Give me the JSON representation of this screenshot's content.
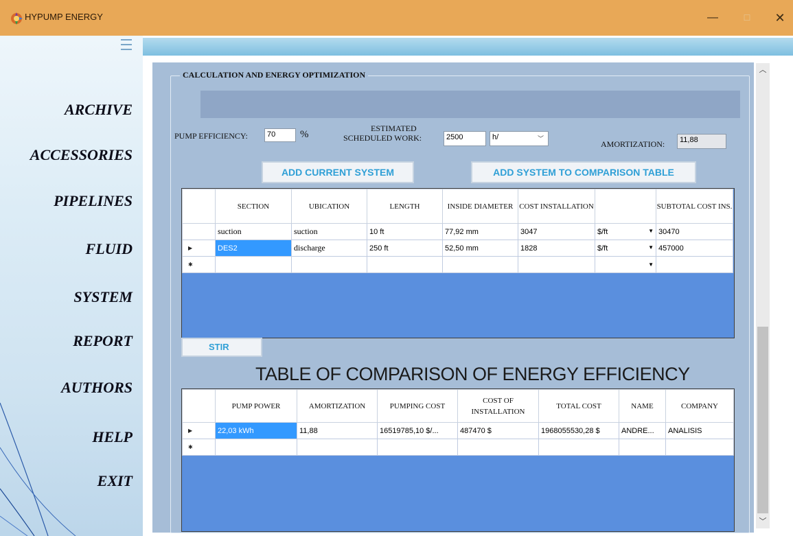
{
  "window": {
    "title": "HYPUMP ENERGY",
    "controls": {
      "minimize": "—",
      "maximize": "☐",
      "close": "✕"
    }
  },
  "sidebar": {
    "items": [
      {
        "id": "archive",
        "label": "ARCHIVE"
      },
      {
        "id": "accessories",
        "label": "ACCESSORIES"
      },
      {
        "id": "pipelines",
        "label": "PIPELINES"
      },
      {
        "id": "fluid",
        "label": "FLUID"
      },
      {
        "id": "system",
        "label": "SYSTEM"
      },
      {
        "id": "report",
        "label": "REPORT"
      },
      {
        "id": "authors",
        "label": "AUTHORS"
      },
      {
        "id": "help",
        "label": "HELP"
      },
      {
        "id": "exit",
        "label": "EXIT"
      }
    ]
  },
  "form": {
    "group_title": "CALCULATION AND ENERGY OPTIMIZATION",
    "pump_efficiency_label": "PUMP EFFICIENCY:",
    "pump_efficiency_value": "70",
    "percent_symbol": "%",
    "scheduled_work_label_line1": "ESTIMATED",
    "scheduled_work_label_line2": "SCHEDULED WORK:",
    "scheduled_work_value": "2500",
    "scheduled_work_unit": "h/",
    "amortization_label": "AMORTIZATION:",
    "amortization_value": "11,88",
    "add_current_system": "ADD CURRENT SYSTEM",
    "add_to_comparison": "ADD SYSTEM TO COMPARISON TABLE",
    "stir_button": "STIR"
  },
  "sections_table": {
    "headers": [
      "SECTION",
      "UBICATION",
      "LENGTH",
      "INSIDE DIAMETER",
      "COST INSTALLATION",
      "",
      "SUBTOTAL COST INS."
    ],
    "rows": [
      {
        "section": "suction",
        "ubication": "suction",
        "length": "10 ft",
        "diameter": "77,92 mm",
        "cost": "3047",
        "unit": "$/ft",
        "subtotal": "30470"
      },
      {
        "section": "DES2",
        "ubication": "discharge",
        "length": "250 ft",
        "diameter": "52,50 mm",
        "cost": "1828",
        "unit": "$/ft",
        "subtotal": "457000"
      }
    ]
  },
  "comparison_title": "TABLE OF COMPARISON OF ENERGY EFFICIENCY",
  "comparison_table": {
    "headers": [
      "PUMP POWER",
      "AMORTIZATION",
      "PUMPING COST",
      "COST OF INSTALLATION",
      "TOTAL COST",
      "NAME",
      "COMPANY"
    ],
    "rows": [
      {
        "pump_power": "22,03 kWh",
        "amortization": "11,88",
        "pumping_cost": "16519785,10 $/...",
        "installation": "487470 $",
        "total": "1968055530,28 $",
        "name": "ANDRE...",
        "company": "ANALISIS"
      }
    ]
  },
  "colors": {
    "titlebar": "#e8a857",
    "panel": "#a6bdd7",
    "grid_background": "#5a8fde",
    "button_text": "#2f9fd6",
    "selection": "#3399ff"
  },
  "icons": [
    "app-icon",
    "menu-icon",
    "minimize-icon",
    "maximize-icon",
    "close-icon",
    "scroll-up-icon",
    "scroll-down-icon",
    "dropdown-arrow-icon",
    "row-pointer-icon",
    "new-row-icon"
  ]
}
